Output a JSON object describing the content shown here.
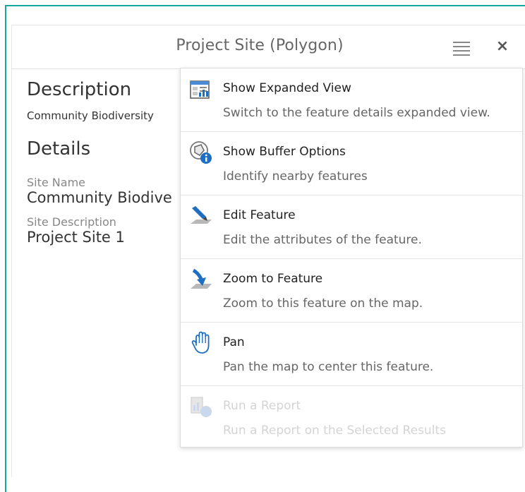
{
  "panel": {
    "title": "Project Site (Polygon)",
    "menu_icon": "hamburger-menu-icon",
    "close_label": "×"
  },
  "content": {
    "description_heading": "Description",
    "description_text": "Community Biodiversity",
    "details_heading": "Details",
    "fields": [
      {
        "label": "Site Name",
        "value": "Community Biodive"
      },
      {
        "label": "Site Description",
        "value": "Project Site 1"
      }
    ]
  },
  "menu": {
    "items": [
      {
        "title": "Show Expanded View",
        "subtitle": "Switch to the feature details expanded view.",
        "icon": "expanded-view-icon",
        "enabled": true
      },
      {
        "title": "Show Buffer Options",
        "subtitle": "Identify nearby features",
        "icon": "buffer-info-icon",
        "enabled": true
      },
      {
        "title": "Edit Feature",
        "subtitle": "Edit the attributes of the feature.",
        "icon": "edit-pen-icon",
        "enabled": true
      },
      {
        "title": "Zoom to Feature",
        "subtitle": "Zoom to this feature on the map.",
        "icon": "zoom-arrow-icon",
        "enabled": true
      },
      {
        "title": "Pan",
        "subtitle": "Pan the map to center this feature.",
        "icon": "hand-icon",
        "enabled": true
      },
      {
        "title": "Run a Report",
        "subtitle": "Run a Report on the Selected Results",
        "icon": "report-icon",
        "enabled": false
      }
    ]
  },
  "colors": {
    "frame_border": "#1aa6a0",
    "icon_blue": "#1e6fc1",
    "disabled_text": "#d4d4d4"
  }
}
